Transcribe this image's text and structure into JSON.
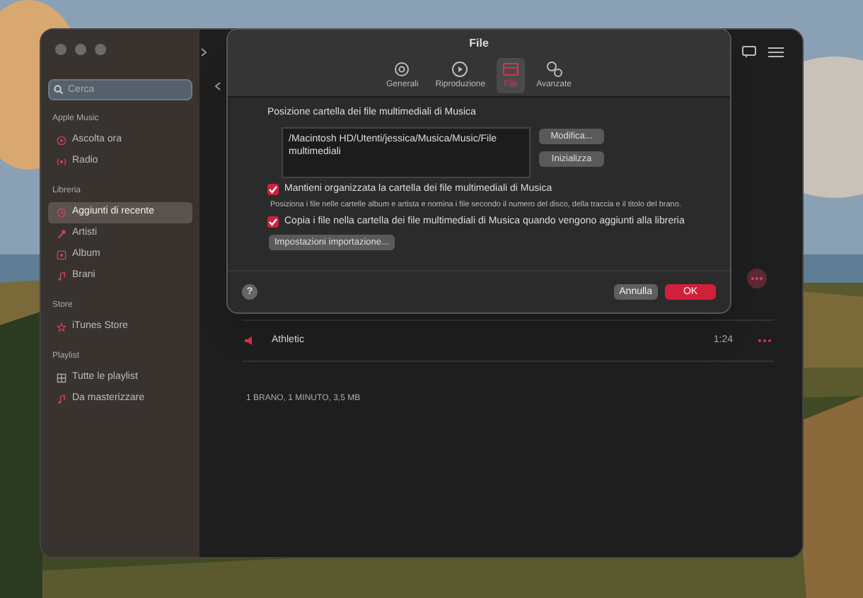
{
  "sidebar": {
    "search": {
      "placeholder": "Cerca"
    },
    "sections": [
      {
        "title": "Apple Music",
        "items": [
          {
            "label": "Ascolta ora",
            "selected": false
          },
          {
            "label": "Radio",
            "selected": false
          }
        ]
      },
      {
        "title": "Libreria",
        "items": [
          {
            "label": "Aggiunti di recente",
            "selected": true
          },
          {
            "label": "Artisti",
            "selected": false
          },
          {
            "label": "Album",
            "selected": false
          },
          {
            "label": "Brani",
            "selected": false
          }
        ]
      },
      {
        "title": "Store",
        "items": [
          {
            "label": "iTunes Store",
            "selected": false
          }
        ]
      },
      {
        "title": "Playlist",
        "items": [
          {
            "label": "Tutte le playlist",
            "selected": false
          },
          {
            "label": "Da masterizzare",
            "selected": false
          }
        ]
      }
    ]
  },
  "tracks": [
    {
      "title": "Athletic",
      "duration": "1:24",
      "playing": true
    }
  ],
  "footer": "1 BRANO, 1 MINUTO, 3,5 MB",
  "dialog": {
    "title": "File",
    "tabs": [
      {
        "label": "Generali",
        "selected": false
      },
      {
        "label": "Riproduzione",
        "selected": false
      },
      {
        "label": "File",
        "selected": true
      },
      {
        "label": "Avanzate",
        "selected": false
      }
    ],
    "folder_label": "Posizione cartella dei file multimediali di Musica",
    "folder_path": "/Macintosh HD/Utenti/jessica/Musica/Music/File multimediali",
    "folder_buttons": [
      "Modifica...",
      "Inizializza"
    ],
    "options": [
      {
        "label": "Mantieni organizzata la cartella dei file multimediali di Musica",
        "checked": true,
        "description": "Posiziona i file nelle cartelle album e artista e nomina i file secondo il numero del disco, della traccia e il titolo del brano."
      },
      {
        "label": "Copia i file nella cartella dei file multimediali di Musica quando vengono aggiunti alla libreria",
        "checked": true
      }
    ],
    "import_button": "Impostazioni importazione...",
    "help": "?",
    "cancel": "Annulla",
    "ok": "OK"
  }
}
